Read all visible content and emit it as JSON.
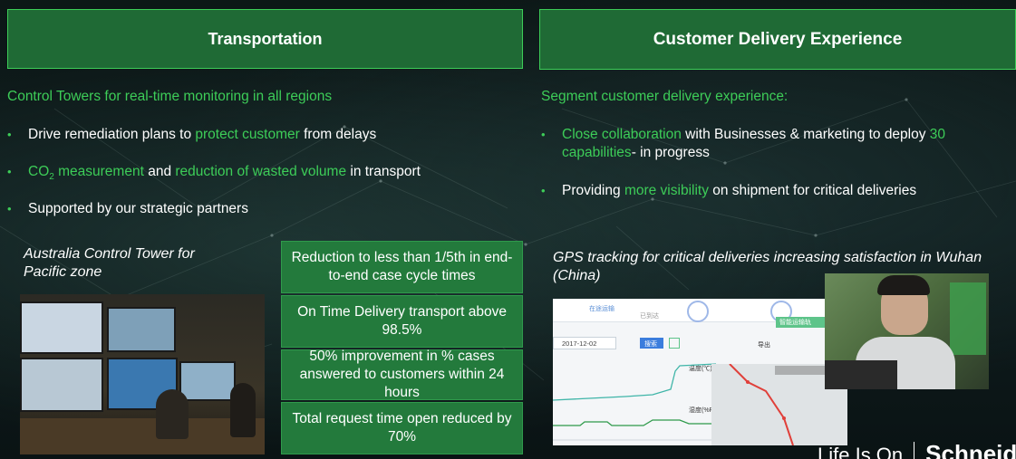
{
  "left": {
    "header": "Transportation",
    "subtitle": "Control Towers for real-time monitoring in all regions",
    "bullets": [
      {
        "pre": "Drive remediation plans to ",
        "hl": "protect customer",
        "post": " from delays"
      },
      {
        "pre": "",
        "hl": "CO",
        "sub": "2",
        "hl2": " measurement",
        "mid": " and ",
        "hl3": "reduction of wasted volume",
        "post": " in transport"
      },
      {
        "pre": "Supported by our strategic partners",
        "hl": "",
        "post": ""
      }
    ],
    "caption": "Australia Control Tower for Pacific zone",
    "metrics": [
      "Reduction to less than 1/5th in end-to-end case cycle times",
      "On Time Delivery transport above  98.5%",
      "50% improvement in % cases answered to customers within 24 hours",
      "Total request time open reduced by 70%"
    ]
  },
  "right": {
    "header": "Customer Delivery Experience",
    "subtitle": "Segment customer delivery experience:",
    "bullets": [
      {
        "hl": "Close collaboration",
        "mid": " with Businesses & marketing to deploy ",
        "hl2": "30 capabilities",
        "post": "- in progress"
      },
      {
        "pre": "Providing ",
        "hl": "more visibility",
        "post": " on shipment for critical deliveries"
      }
    ],
    "caption": "GPS tracking for critical deliveries increasing satisfaction in Wuhan (China)",
    "gps": {
      "date": "2017-12-02",
      "search_btn": "搜索",
      "label_temp": "温度(℃)",
      "label_hum": "湿度(%RH)",
      "legend_1": "在途运输",
      "legend_2": "已到达",
      "info_1": "智能运输轨",
      "info_2": "导出"
    }
  },
  "footer": {
    "slogan": "Life Is On",
    "brand": "Schneid"
  },
  "colors": {
    "accent": "#3dcd58",
    "header_bg": "#1f6a35",
    "metric_bg": "#237a3c"
  }
}
